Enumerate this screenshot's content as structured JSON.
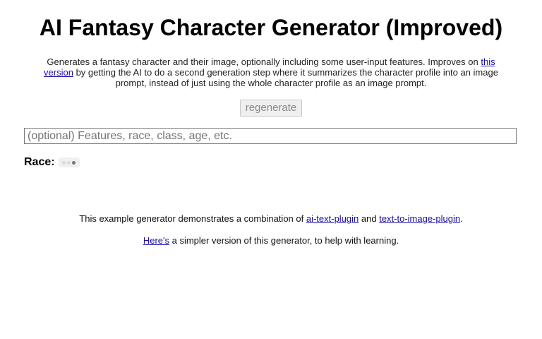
{
  "header": {
    "title": "AI Fantasy Character Generator (Improved)"
  },
  "description": {
    "text_before_link": "Generates a fantasy character and their image, optionally including some user-input features. Improves on ",
    "link_text": "this version",
    "text_after_link": " by getting the AI to do a second generation step where it summarizes the character profile into an image prompt, instead of just using the whole character profile as an image prompt."
  },
  "controls": {
    "regenerate_label": "regenerate",
    "features_placeholder": "(optional) Features, race, class, age, etc."
  },
  "output": {
    "race_label": "Race:",
    "race_status_icon": "loading-dots-icon"
  },
  "footer": {
    "line1_before": "This example generator demonstrates a combination of ",
    "line1_link1": "ai-text-plugin",
    "line1_middle": " and ",
    "line1_link2": "text-to-image-plugin",
    "line1_after": ".",
    "line2_link": "Here's",
    "line2_after": " a simpler version of this generator, to help with learning."
  },
  "colors": {
    "link": "#1a0dab",
    "button_text_disabled": "#8a8a8a"
  }
}
